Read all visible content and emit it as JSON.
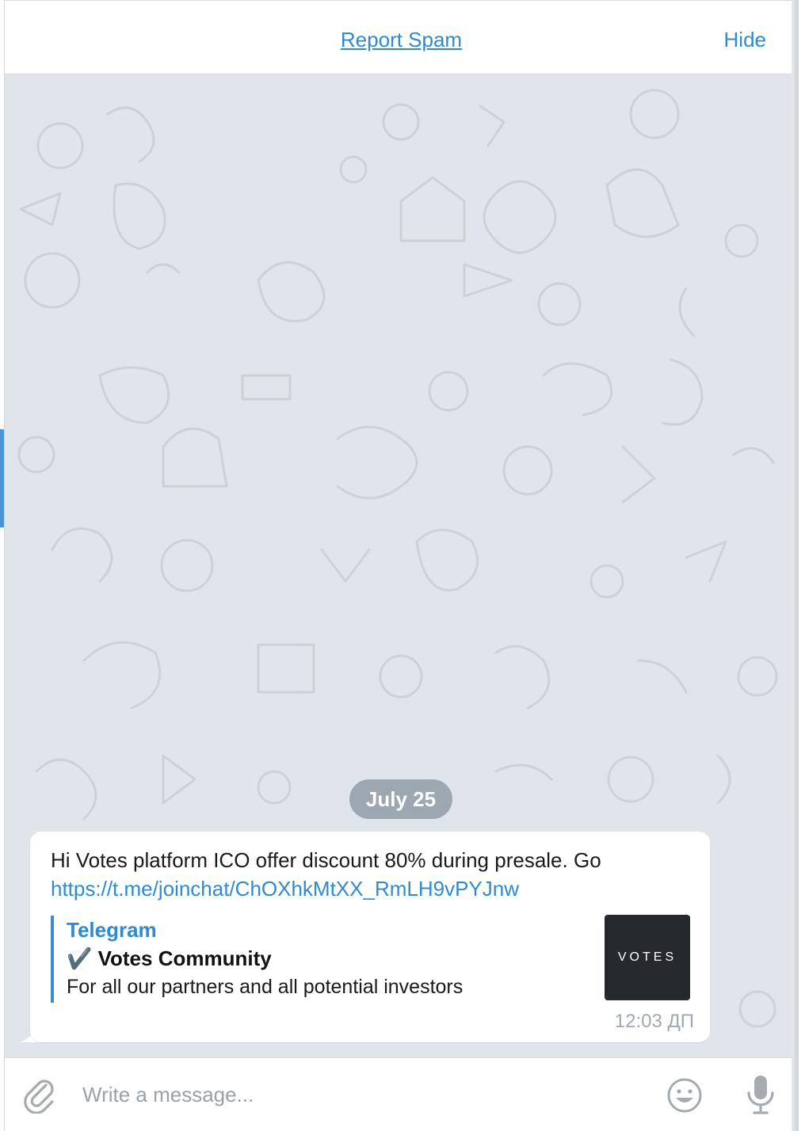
{
  "header": {
    "report_spam_label": "Report Spam",
    "hide_label": "Hide"
  },
  "chat": {
    "date_label": "July 25",
    "message": {
      "text": "Hi Votes platform ICO offer discount 80% during presale. Go",
      "link": "https://t.me/joinchat/ChOXhkMtXX_RmLH9vPYJnw",
      "preview": {
        "site_name": "Telegram",
        "title": "✔️ Votes Community",
        "description": "For all our partners and all potential investors",
        "thumbnail_text": "VOTES"
      },
      "time": "12:03 ДП"
    }
  },
  "composer": {
    "placeholder": "Write a message..."
  },
  "colors": {
    "accent": "#2f8ad0",
    "chat_background": "#dfe5ea",
    "date_pill": "#8a96a0",
    "thumbnail": "#262a2f"
  },
  "icons": {
    "attach": "paperclip-icon",
    "emoji": "smiley-icon",
    "voice": "microphone-icon"
  }
}
